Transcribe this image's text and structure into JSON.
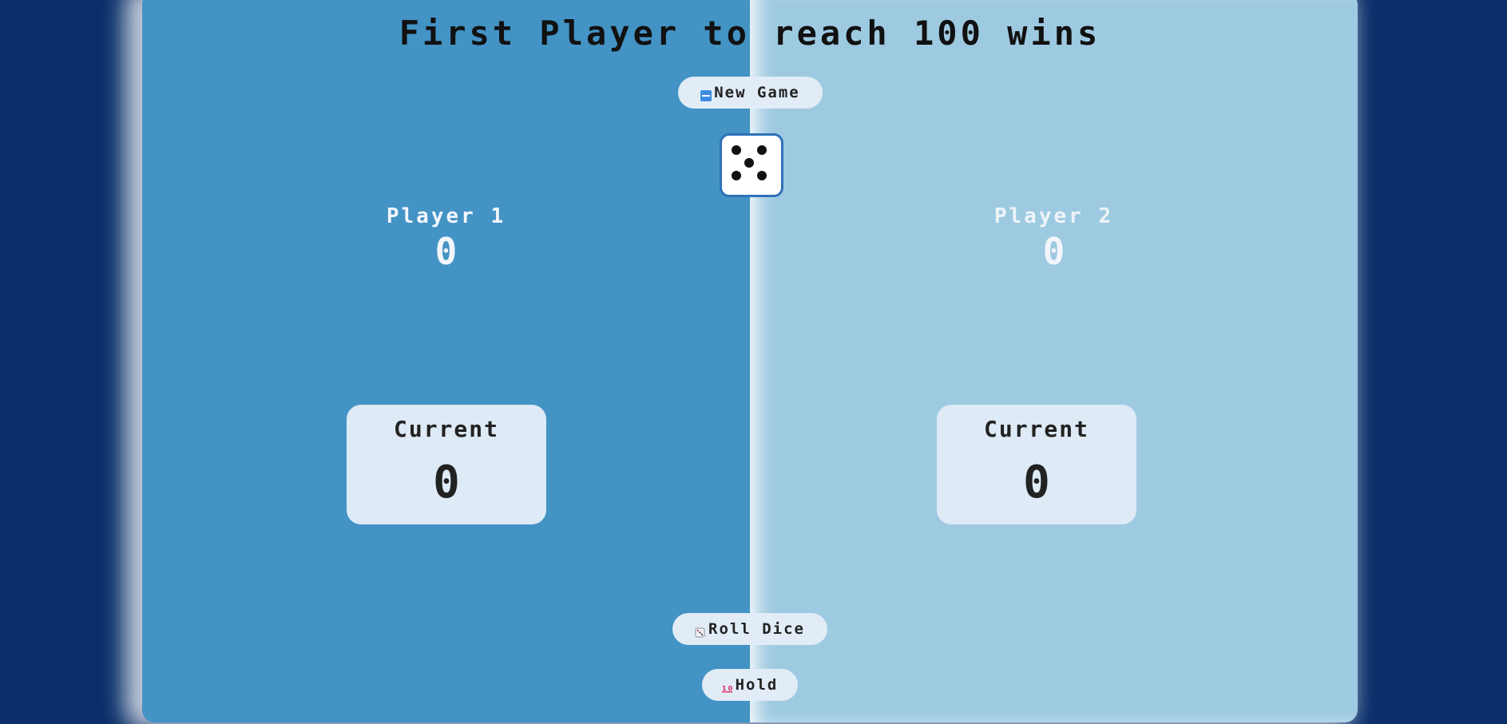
{
  "title": "First Player to reach 100 wins",
  "buttons": {
    "new_game": "New Game",
    "roll_dice": "Roll Dice",
    "hold": "Hold"
  },
  "icons": {
    "new_game": "new-badge-icon",
    "roll_dice": "dice-icon",
    "hold": "hundred-points-icon"
  },
  "dice": {
    "value": 5
  },
  "players": [
    {
      "name": "Player 1",
      "score": "0",
      "current_label": "Current",
      "current": "0",
      "active": true
    },
    {
      "name": "Player 2",
      "score": "0",
      "current_label": "Current",
      "current": "0",
      "active": false
    }
  ],
  "colors": {
    "page_background": "#0a2f6a",
    "active_panel": "#4393c5",
    "inactive_panel": "#9ecae1",
    "button_background": "#e1ecf7",
    "dice_border": "#2e72b8"
  }
}
